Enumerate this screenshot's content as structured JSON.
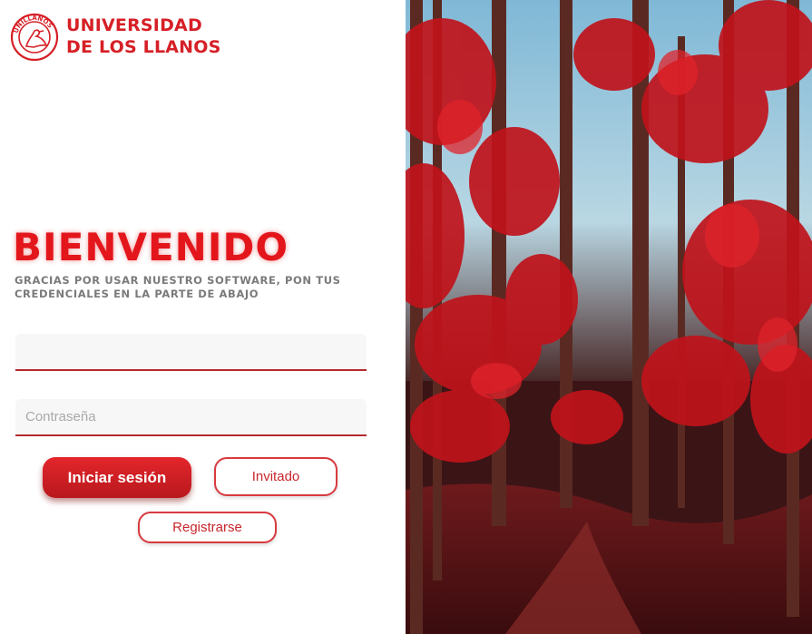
{
  "logo": {
    "line1": "UNIVERSIDAD",
    "line2": "DE LOS LLANOS",
    "seal_text": "UNILLANOS",
    "color": "#d61f26"
  },
  "welcome": {
    "title": "BIENVENIDO",
    "subtitle": "GRACIAS POR USAR NUESTRO SOFTWARE, PON TUS CREDENCIALES EN LA PARTE DE ABAJO"
  },
  "form": {
    "username": {
      "value": "",
      "placeholder": ""
    },
    "password": {
      "value": "",
      "placeholder": "Contraseña"
    }
  },
  "buttons": {
    "login": "Iniciar sesión",
    "guest": "Invitado",
    "register": "Registrarse"
  },
  "image": {
    "subject": "red autumn forest",
    "icon": "forest-photo"
  },
  "colors": {
    "accent": "#e3161c",
    "subtitle": "#7a7a7a",
    "input_bg": "#f7f7f7",
    "input_underline": "#b52a2d"
  }
}
